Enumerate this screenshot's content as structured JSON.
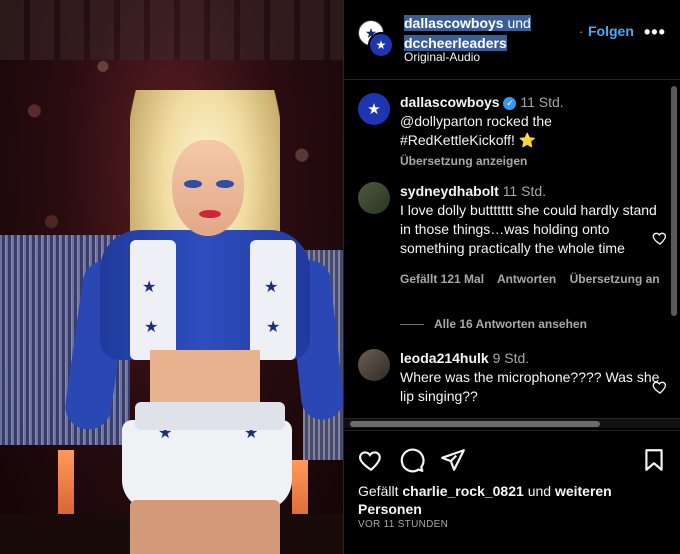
{
  "post": {
    "author_1": "dallascowboys",
    "joiner": "und",
    "author_2": "dccheerleaders",
    "audio": "Original-Audio",
    "follow_label": "Folgen",
    "more_label": "•••"
  },
  "caption": {
    "username": "dallascowboys",
    "time": "11 Std.",
    "text": "@dollyparton rocked the #RedKettleKickoff! ⭐",
    "translate_label": "Übersetzung anzeigen"
  },
  "comments": [
    {
      "username": "sydneydhabolt",
      "time": "11 Std.",
      "text": "I love dolly buttttttt she could hardly stand in those things…was holding onto something practically the whole time",
      "likes": "Gefällt 121 Mal",
      "reply_label": "Antworten",
      "translate_label": "Übersetzung an",
      "view_replies": "Alle 16 Antworten ansehen"
    },
    {
      "username": "leoda214hulk",
      "time": "9 Std.",
      "text": "Where was the microphone???? Was she lip singing??"
    }
  ],
  "footer": {
    "liked_by_prefix": "Gefällt",
    "liked_by_user": "charlie_rock_0821",
    "liked_by_middle": "und",
    "liked_by_suffix": "weiteren Personen",
    "timestamp": "VOR 11 STUNDEN"
  },
  "colors": {
    "background": "#000000",
    "follow_blue": "#4aa8f7",
    "verified_blue": "#3897f0",
    "muted": "#a8a8a8",
    "selection": "#3b5e96"
  },
  "icons": [
    "heart-icon",
    "comment-icon",
    "share-icon",
    "bookmark-icon",
    "verified-icon",
    "more-icon"
  ]
}
